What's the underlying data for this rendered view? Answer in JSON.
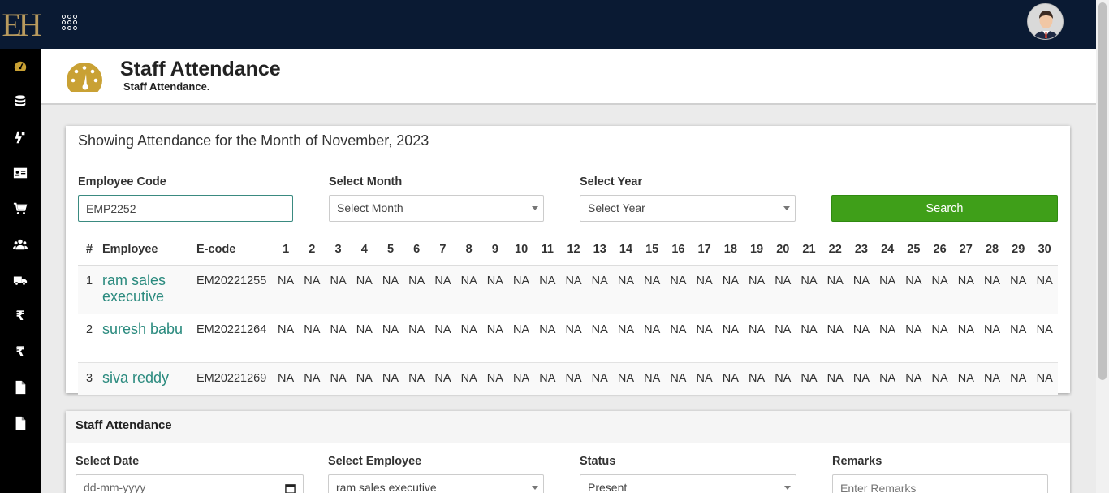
{
  "brand": {
    "logo_text": "EH"
  },
  "sidebar": {
    "items": [
      {
        "name": "dashboard",
        "icon": "tachometer-icon"
      },
      {
        "name": "database",
        "icon": "database-icon"
      },
      {
        "name": "transfer",
        "icon": "exchange-icon"
      },
      {
        "name": "id-card",
        "icon": "id-card-icon"
      },
      {
        "name": "cart",
        "icon": "cart-icon"
      },
      {
        "name": "users",
        "icon": "users-icon"
      },
      {
        "name": "delivery",
        "icon": "truck-icon"
      },
      {
        "name": "rupee-1",
        "icon": "rupee-icon"
      },
      {
        "name": "rupee-2",
        "icon": "rupee-icon"
      },
      {
        "name": "file-1",
        "icon": "file-icon"
      },
      {
        "name": "file-2",
        "icon": "file-icon"
      }
    ]
  },
  "header": {
    "title": "Staff Attendance",
    "subtitle": "Staff Attendance."
  },
  "colors": {
    "topbar": "#0a1a33",
    "sidebar": "#000000",
    "accent_gold": "#c9a134",
    "link": "#2a8a7e",
    "search_button": "#3f9f19"
  },
  "attendance_card": {
    "heading": "Showing Attendance for the Month of November, 2023",
    "employee_code_label": "Employee Code",
    "employee_code_value": "EMP2252",
    "month_label": "Select Month",
    "month_value": "Select Month",
    "year_label": "Select Year",
    "year_value": "Select Year",
    "search_label": "Search",
    "table": {
      "col_index": "#",
      "col_employee": "Employee",
      "col_ecode": "E-code",
      "days": [
        "1",
        "2",
        "3",
        "4",
        "5",
        "6",
        "7",
        "8",
        "9",
        "10",
        "11",
        "12",
        "13",
        "14",
        "15",
        "16",
        "17",
        "18",
        "19",
        "20",
        "21",
        "22",
        "23",
        "24",
        "25",
        "26",
        "27",
        "28",
        "29",
        "30"
      ],
      "rows": [
        {
          "index": "1",
          "name": "ram sales executive",
          "ecode": "EM20221255",
          "values": [
            "NA",
            "NA",
            "NA",
            "NA",
            "NA",
            "NA",
            "NA",
            "NA",
            "NA",
            "NA",
            "NA",
            "NA",
            "NA",
            "NA",
            "NA",
            "NA",
            "NA",
            "NA",
            "NA",
            "NA",
            "NA",
            "NA",
            "NA",
            "NA",
            "NA",
            "NA",
            "NA",
            "NA",
            "NA",
            "NA"
          ]
        },
        {
          "index": "2",
          "name": "suresh babu",
          "ecode": "EM20221264",
          "values": [
            "NA",
            "NA",
            "NA",
            "NA",
            "NA",
            "NA",
            "NA",
            "NA",
            "NA",
            "NA",
            "NA",
            "NA",
            "NA",
            "NA",
            "NA",
            "NA",
            "NA",
            "NA",
            "NA",
            "NA",
            "NA",
            "NA",
            "NA",
            "NA",
            "NA",
            "NA",
            "NA",
            "NA",
            "NA",
            "NA"
          ]
        },
        {
          "index": "3",
          "name": "siva reddy",
          "ecode": "EM20221269",
          "values": [
            "NA",
            "NA",
            "NA",
            "NA",
            "NA",
            "NA",
            "NA",
            "NA",
            "NA",
            "NA",
            "NA",
            "NA",
            "NA",
            "NA",
            "NA",
            "NA",
            "NA",
            "NA",
            "NA",
            "NA",
            "NA",
            "NA",
            "NA",
            "NA",
            "NA",
            "NA",
            "NA",
            "NA",
            "NA",
            "NA"
          ]
        }
      ]
    }
  },
  "staff_form": {
    "heading": "Staff Attendance",
    "date_label": "Select Date",
    "date_placeholder": "dd-mm-yyyy",
    "employee_label": "Select Employee",
    "employee_value": "ram sales executive",
    "status_label": "Status",
    "status_value": "Present",
    "remarks_label": "Remarks",
    "remarks_placeholder": "Enter Remarks"
  }
}
